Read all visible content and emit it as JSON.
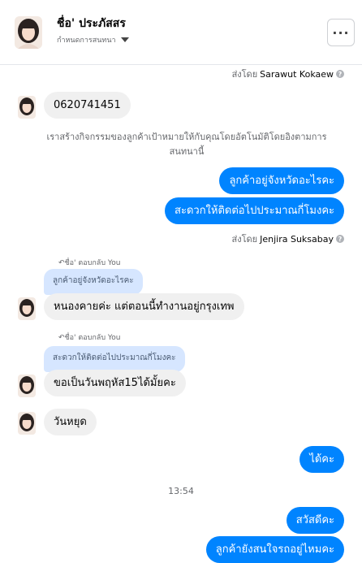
{
  "header": {
    "name": "ชื่อ' ประภัสสร",
    "subtitle": "กำหนดการสนทนา"
  },
  "messages": {
    "sent_by_1": "ส่งโดย",
    "sent_by_1_name": "Sarawut Kokaew",
    "m1": "0620741451",
    "system_note": "เราสร้างกิจกรรมของลูกค้าเป้าหมายให้กับคุณโดยอัตโนมัติโดยอิงตามการสนทนานี้",
    "m2": "ลูกค้าอยู่จังหวัดอะไรคะ",
    "m3": "สะดวกให้ติดต่อไปประมาณกี่โมงคะ",
    "sent_by_2": "ส่งโดย",
    "sent_by_2_name": "Jenjira Suksabay",
    "reply_label_1": "ชื่อ' ตอบกลับ You",
    "quote_1": "ลูกค้าอยู่จังหวัดอะไรคะ",
    "m4": "หนองคายค่ะ แต่ตอนนี้ทำงานอยู่กรุงเทพ",
    "reply_label_2": "ชื่อ' ตอบกลับ You",
    "quote_2": "สะดวกให้ติดต่อไปประมาณกี่โมงคะ",
    "m5": "ขอเป็นวันพฤหัส15ได้มั้ยคะ",
    "m6": "วันหยุด",
    "m7": "ได้คะ",
    "time": "13:54",
    "m8": "สวัสดีคะ",
    "m9": "ลูกค้ายังสนใจรถอยู่ไหมคะ"
  },
  "colors": {
    "outgoing_bubble": "#0084ff",
    "incoming_bubble": "#f0f0f0",
    "quote_bubble": "#d6e6ff"
  }
}
